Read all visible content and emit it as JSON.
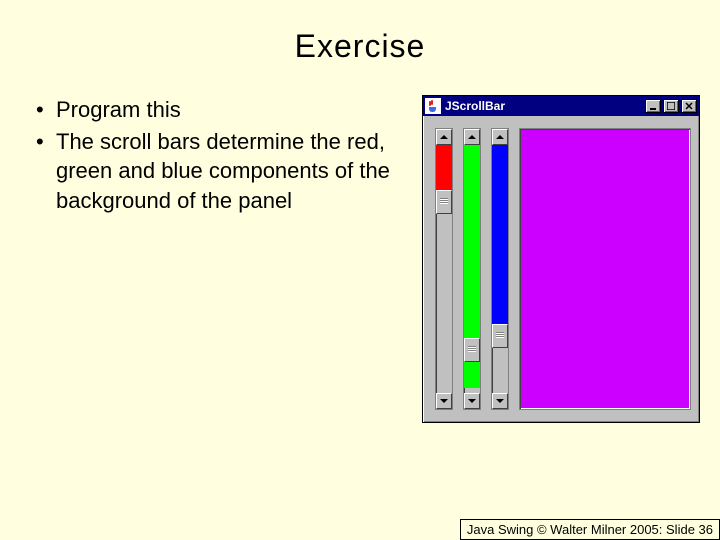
{
  "title": "Exercise",
  "bullets": [
    "Program this",
    "The scroll bars determine the red, green and blue components of the background of the panel"
  ],
  "window": {
    "title": "JScrollBar",
    "buttons": {
      "min": "_",
      "max": "□",
      "close": "×"
    },
    "scrollbars": [
      {
        "name": "red",
        "fill_color": "#ff0000",
        "fill_pct": 18,
        "thumb_pos_pct": 18
      },
      {
        "name": "green",
        "fill_color": "#00ff00",
        "fill_pct": 98,
        "thumb_pos_pct": 78
      },
      {
        "name": "blue",
        "fill_color": "#0000ff",
        "fill_pct": 72,
        "thumb_pos_pct": 72
      }
    ],
    "panel_color": "#cc00ff"
  },
  "footer": "Java Swing © Walter Milner 2005: Slide 36"
}
